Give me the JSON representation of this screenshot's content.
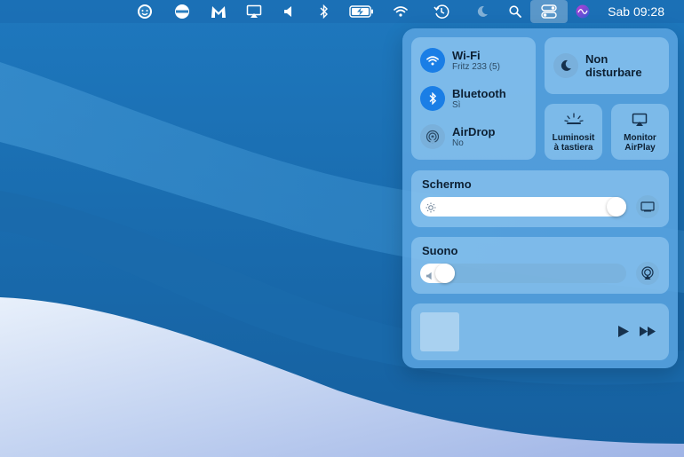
{
  "menubar": {
    "clock": "Sab 09:28",
    "icons": [
      "face-app-icon",
      "minus-circle-icon",
      "malwarebytes-icon",
      "airplay-icon",
      "volume-icon",
      "bluetooth-icon",
      "battery-charging-icon",
      "wifi-icon",
      "time-machine-icon",
      "moon-icon",
      "search-icon",
      "control-center-icon",
      "siri-icon"
    ]
  },
  "control_center": {
    "wifi": {
      "title": "Wi-Fi",
      "subtitle": "Fritz 233 (5)",
      "on": true
    },
    "bluetooth": {
      "title": "Bluetooth",
      "subtitle": "Sì",
      "on": true
    },
    "airdrop": {
      "title": "AirDrop",
      "subtitle": "No",
      "on": false
    },
    "dnd": {
      "line1": "Non",
      "line2": "disturbare"
    },
    "keyboard_brightness": {
      "line1": "Luminosit",
      "line2": "à tastiera"
    },
    "airplay_monitor": {
      "line1": "Monitor",
      "line2": "AirPlay"
    },
    "display": {
      "title": "Schermo",
      "level": 1.0
    },
    "sound": {
      "title": "Suono",
      "level": 0.08
    }
  },
  "colors": {
    "accent": "#1a7ee6",
    "wallpaper": "#1b6fb0"
  }
}
